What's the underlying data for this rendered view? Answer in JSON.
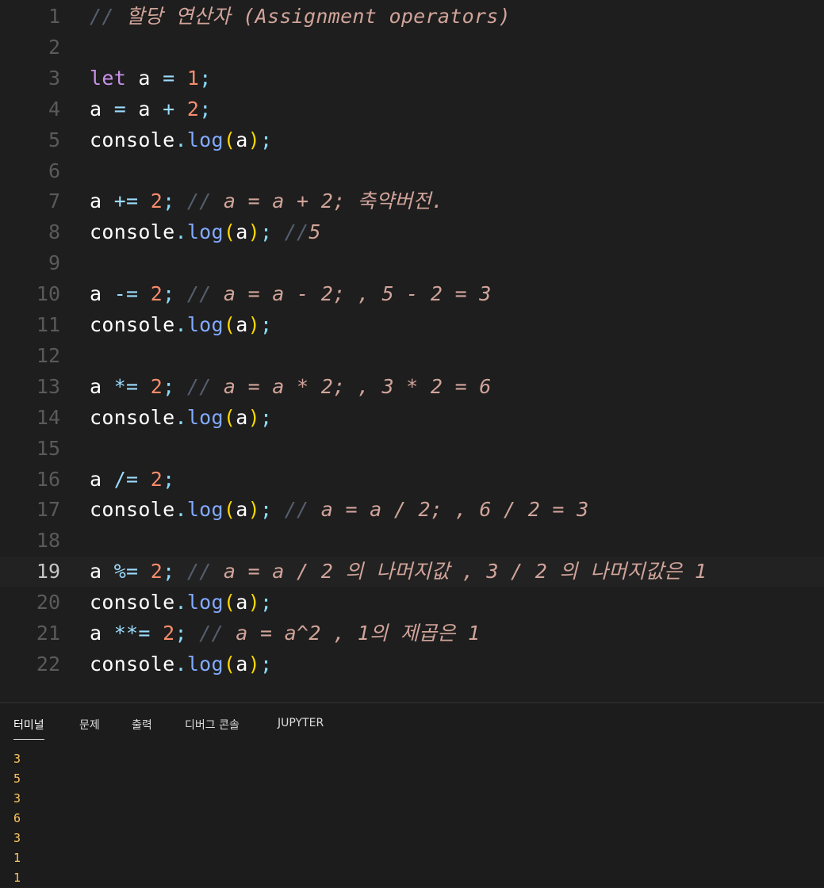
{
  "editor": {
    "active_line": 19,
    "lines": [
      {
        "n": "1",
        "tokens": [
          [
            "comment-slash",
            "// "
          ],
          [
            "comment",
            "할당 연산자 (Assignment operators)"
          ]
        ]
      },
      {
        "n": "2",
        "tokens": []
      },
      {
        "n": "3",
        "tokens": [
          [
            "kw",
            "let"
          ],
          [
            "id",
            " a "
          ],
          [
            "op",
            "="
          ],
          [
            "id",
            " "
          ],
          [
            "num",
            "1"
          ],
          [
            "punct",
            ";"
          ]
        ]
      },
      {
        "n": "4",
        "tokens": [
          [
            "id",
            "a "
          ],
          [
            "op",
            "="
          ],
          [
            "id",
            " a "
          ],
          [
            "op",
            "+"
          ],
          [
            "id",
            " "
          ],
          [
            "num",
            "2"
          ],
          [
            "punct",
            ";"
          ]
        ]
      },
      {
        "n": "5",
        "tokens": [
          [
            "id",
            "console"
          ],
          [
            "punct",
            "."
          ],
          [
            "fn",
            "log"
          ],
          [
            "paren",
            "("
          ],
          [
            "id",
            "a"
          ],
          [
            "paren",
            ")"
          ],
          [
            "punct",
            ";"
          ]
        ]
      },
      {
        "n": "6",
        "tokens": []
      },
      {
        "n": "7",
        "tokens": [
          [
            "id",
            "a "
          ],
          [
            "op",
            "+="
          ],
          [
            "id",
            " "
          ],
          [
            "num",
            "2"
          ],
          [
            "punct",
            ";"
          ],
          [
            "id",
            " "
          ],
          [
            "comment-slash",
            "// "
          ],
          [
            "comment",
            "a = a + 2; 축약버전."
          ]
        ]
      },
      {
        "n": "8",
        "tokens": [
          [
            "id",
            "console"
          ],
          [
            "punct",
            "."
          ],
          [
            "fn",
            "log"
          ],
          [
            "paren",
            "("
          ],
          [
            "id",
            "a"
          ],
          [
            "paren",
            ")"
          ],
          [
            "punct",
            ";"
          ],
          [
            "id",
            " "
          ],
          [
            "comment-slash",
            "//"
          ],
          [
            "comment",
            "5"
          ]
        ]
      },
      {
        "n": "9",
        "tokens": []
      },
      {
        "n": "10",
        "tokens": [
          [
            "id",
            "a "
          ],
          [
            "op",
            "-="
          ],
          [
            "id",
            " "
          ],
          [
            "num",
            "2"
          ],
          [
            "punct",
            ";"
          ],
          [
            "id",
            " "
          ],
          [
            "comment-slash",
            "// "
          ],
          [
            "comment",
            "a = a - 2; , 5 - 2 = 3"
          ]
        ]
      },
      {
        "n": "11",
        "tokens": [
          [
            "id",
            "console"
          ],
          [
            "punct",
            "."
          ],
          [
            "fn",
            "log"
          ],
          [
            "paren",
            "("
          ],
          [
            "id",
            "a"
          ],
          [
            "paren",
            ")"
          ],
          [
            "punct",
            ";"
          ]
        ]
      },
      {
        "n": "12",
        "tokens": []
      },
      {
        "n": "13",
        "tokens": [
          [
            "id",
            "a "
          ],
          [
            "op",
            "*="
          ],
          [
            "id",
            " "
          ],
          [
            "num",
            "2"
          ],
          [
            "punct",
            ";"
          ],
          [
            "id",
            " "
          ],
          [
            "comment-slash",
            "// "
          ],
          [
            "comment",
            "a = a * 2; , 3 * 2 = 6"
          ]
        ]
      },
      {
        "n": "14",
        "tokens": [
          [
            "id",
            "console"
          ],
          [
            "punct",
            "."
          ],
          [
            "fn",
            "log"
          ],
          [
            "paren",
            "("
          ],
          [
            "id",
            "a"
          ],
          [
            "paren",
            ")"
          ],
          [
            "punct",
            ";"
          ]
        ]
      },
      {
        "n": "15",
        "tokens": []
      },
      {
        "n": "16",
        "tokens": [
          [
            "id",
            "a "
          ],
          [
            "op",
            "/="
          ],
          [
            "id",
            " "
          ],
          [
            "num",
            "2"
          ],
          [
            "punct",
            ";"
          ]
        ]
      },
      {
        "n": "17",
        "tokens": [
          [
            "id",
            "console"
          ],
          [
            "punct",
            "."
          ],
          [
            "fn",
            "log"
          ],
          [
            "paren",
            "("
          ],
          [
            "id",
            "a"
          ],
          [
            "paren",
            ")"
          ],
          [
            "punct",
            ";"
          ],
          [
            "id",
            " "
          ],
          [
            "comment-slash",
            "// "
          ],
          [
            "comment",
            "a = a / 2; , 6 / 2 = 3"
          ]
        ]
      },
      {
        "n": "18",
        "tokens": []
      },
      {
        "n": "19",
        "tokens": [
          [
            "id",
            "a "
          ],
          [
            "op",
            "%="
          ],
          [
            "id",
            " "
          ],
          [
            "num",
            "2"
          ],
          [
            "punct",
            ";"
          ],
          [
            "id",
            " "
          ],
          [
            "comment-slash",
            "// "
          ],
          [
            "comment",
            "a = a / 2 의 나머지값 , 3 / 2 의 나머지값은 1"
          ]
        ]
      },
      {
        "n": "20",
        "tokens": [
          [
            "id",
            "console"
          ],
          [
            "punct",
            "."
          ],
          [
            "fn",
            "log"
          ],
          [
            "paren",
            "("
          ],
          [
            "id",
            "a"
          ],
          [
            "paren",
            ")"
          ],
          [
            "punct",
            ";"
          ]
        ]
      },
      {
        "n": "21",
        "tokens": [
          [
            "id",
            "a "
          ],
          [
            "op",
            "**="
          ],
          [
            "id",
            " "
          ],
          [
            "num",
            "2"
          ],
          [
            "punct",
            ";"
          ],
          [
            "id",
            " "
          ],
          [
            "comment-slash",
            "// "
          ],
          [
            "comment",
            "a = a^2 , 1의 제곱은 1"
          ]
        ]
      },
      {
        "n": "22",
        "tokens": [
          [
            "id",
            "console"
          ],
          [
            "punct",
            "."
          ],
          [
            "fn",
            "log"
          ],
          [
            "paren",
            "("
          ],
          [
            "id",
            "a"
          ],
          [
            "paren",
            ")"
          ],
          [
            "punct",
            ";"
          ]
        ]
      }
    ]
  },
  "panel": {
    "tabs": [
      {
        "label": "터미널",
        "active": true
      },
      {
        "label": "문제",
        "active": false
      },
      {
        "label": "출력",
        "active": false
      },
      {
        "label": "디버그 콘솔",
        "active": false
      },
      {
        "label": "JUPYTER",
        "active": false
      }
    ],
    "terminal_output": [
      "3",
      "5",
      "3",
      "6",
      "3",
      "1",
      "1"
    ]
  },
  "colors": {
    "background": "#1e1e1e",
    "terminal_text": "#ffc864",
    "keyword": "#c792ea",
    "number": "#f78c6c",
    "function": "#82aaff",
    "paren": "#ffd700",
    "comment": "#d1a49a"
  }
}
